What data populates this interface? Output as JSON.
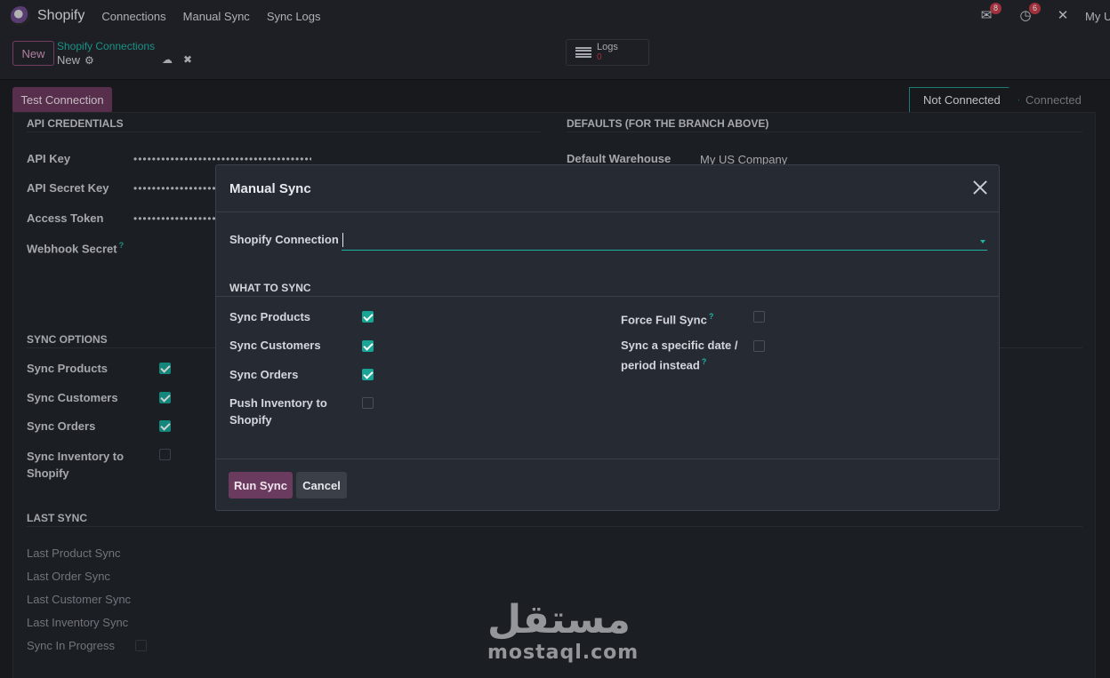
{
  "navbar": {
    "app_name": "Shopify",
    "menu": [
      "Connections",
      "Manual Sync",
      "Sync Logs"
    ],
    "messages_count": "8",
    "activities_count": "6",
    "user": "My U"
  },
  "control": {
    "new_label": "New",
    "breadcrumb_parent": "Shopify Connections",
    "breadcrumb_current": "New",
    "logs_label": "Logs",
    "logs_count": "0"
  },
  "statusbar": {
    "test_label": "Test Connection",
    "stages": [
      "Not Connected",
      "Connected"
    ]
  },
  "form": {
    "api_section": "API CREDENTIALS",
    "defaults_section": "DEFAULTS (FOR THE BRANCH ABOVE)",
    "api_key_label": "API Key",
    "api_key_value": "••••••••••••••••••••••••••••••••••••••••",
    "api_secret_label": "API Secret Key",
    "api_secret_value": "••••••••••••••••••••••••••••••",
    "token_label": "Access Token",
    "token_value": "••••••••••••••••••••••••••••••",
    "webhook_label": "Webhook Secret",
    "warehouse_label": "Default Warehouse",
    "warehouse_value": "My US Company",
    "sync_section": "SYNC OPTIONS",
    "sync_products": "Sync Products",
    "sync_customers": "Sync Customers",
    "sync_orders": "Sync Orders",
    "sync_inventory": "Sync Inventory to Shopify",
    "last_section": "LAST SYNC",
    "last_product": "Last Product Sync",
    "last_order": "Last Order Sync",
    "last_customer": "Last Customer Sync",
    "last_inventory": "Last Inventory Sync",
    "in_progress": "Sync In Progress"
  },
  "modal": {
    "title": "Manual Sync",
    "connection_label": "Shopify Connection",
    "connection_value": "",
    "section": "WHAT TO SYNC",
    "sync_products": "Sync Products",
    "sync_customers": "Sync Customers",
    "sync_orders": "Sync Orders",
    "push_inventory": "Push Inventory to Shopify",
    "force_full": "Force Full Sync",
    "specific_date": "Sync a specific date / period instead",
    "help_mark": "?",
    "checked": {
      "sync_products": true,
      "sync_customers": true,
      "sync_orders": true,
      "push_inventory": false,
      "force_full": false,
      "specific_date": false
    },
    "run_label": "Run Sync",
    "cancel_label": "Cancel"
  },
  "watermark": {
    "arabic": "مستقل",
    "latin": "mostaql.com"
  },
  "colors": {
    "accent": "#20b2a2",
    "primary": "#6b3a5f",
    "checkbox": "#18a596",
    "badge": "#c23b4a"
  }
}
